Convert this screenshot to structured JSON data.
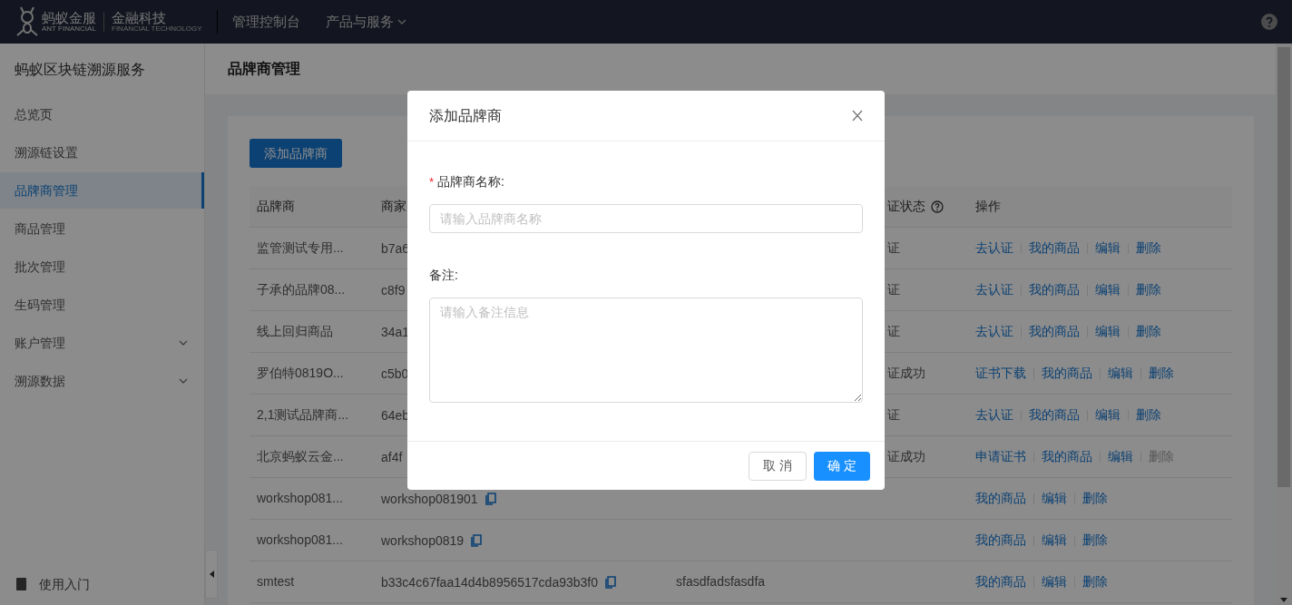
{
  "topbar": {
    "logo_cn": "蚂蚁金服",
    "logo_en": "ANT FINANCIAL",
    "brand_cn": "金融科技",
    "brand_en": "FINANCIAL TECHNOLOGY",
    "nav": [
      {
        "label": "管理控制台",
        "dropdown": false
      },
      {
        "label": "产品与服务",
        "dropdown": true
      }
    ]
  },
  "sidebar": {
    "title": "蚂蚁区块链溯源服务",
    "items": [
      {
        "label": "总览页",
        "selected": false,
        "expandable": false
      },
      {
        "label": "溯源链设置",
        "selected": false,
        "expandable": false
      },
      {
        "label": "品牌商管理",
        "selected": true,
        "expandable": false
      },
      {
        "label": "商品管理",
        "selected": false,
        "expandable": false
      },
      {
        "label": "批次管理",
        "selected": false,
        "expandable": false
      },
      {
        "label": "生码管理",
        "selected": false,
        "expandable": false
      },
      {
        "label": "账户管理",
        "selected": false,
        "expandable": true
      },
      {
        "label": "溯源数据",
        "selected": false,
        "expandable": true
      }
    ],
    "footer": "使用入门"
  },
  "page": {
    "title": "品牌商管理",
    "add_button": "添加品牌商",
    "table": {
      "columns": [
        {
          "label": "品牌商",
          "help": false
        },
        {
          "label": "商家",
          "help": false
        },
        {
          "label": "证状态",
          "help": true
        },
        {
          "label": "操作",
          "help": false
        }
      ],
      "rows": [
        {
          "brand": "监管测试专用...",
          "merchant": "b7a6",
          "status": "证",
          "actions": [
            {
              "label": "去认证",
              "disabled": false
            },
            {
              "label": "我的商品",
              "disabled": false
            },
            {
              "label": "编辑",
              "disabled": false
            },
            {
              "label": "删除",
              "disabled": false
            }
          ]
        },
        {
          "brand": "子承的品牌08...",
          "merchant": "c8f9",
          "status": "证",
          "actions": [
            {
              "label": "去认证",
              "disabled": false
            },
            {
              "label": "我的商品",
              "disabled": false
            },
            {
              "label": "编辑",
              "disabled": false
            },
            {
              "label": "删除",
              "disabled": false
            }
          ]
        },
        {
          "brand": "线上回归商品",
          "merchant": "34a1",
          "status": "证",
          "actions": [
            {
              "label": "去认证",
              "disabled": false
            },
            {
              "label": "我的商品",
              "disabled": false
            },
            {
              "label": "编辑",
              "disabled": false
            },
            {
              "label": "删除",
              "disabled": false
            }
          ]
        },
        {
          "brand": "罗伯特0819O...",
          "merchant": "c5b0",
          "status": "证成功",
          "actions": [
            {
              "label": "证书下载",
              "disabled": false
            },
            {
              "label": "我的商品",
              "disabled": false
            },
            {
              "label": "编辑",
              "disabled": false
            },
            {
              "label": "删除",
              "disabled": false
            }
          ]
        },
        {
          "brand": "2,1测试品牌商...",
          "merchant": "64eb",
          "status": "证",
          "actions": [
            {
              "label": "去认证",
              "disabled": false
            },
            {
              "label": "我的商品",
              "disabled": false
            },
            {
              "label": "编辑",
              "disabled": false
            },
            {
              "label": "删除",
              "disabled": false
            }
          ]
        },
        {
          "brand": "北京蚂蚁云金...",
          "merchant": "af4f",
          "status": "证成功",
          "actions": [
            {
              "label": "申请证书",
              "disabled": false
            },
            {
              "label": "我的商品",
              "disabled": false
            },
            {
              "label": "编辑",
              "disabled": false
            },
            {
              "label": "删除",
              "disabled": true
            }
          ]
        },
        {
          "brand": "workshop081...",
          "merchant": "workshop081901",
          "copy": true,
          "actions": [
            {
              "label": "我的商品",
              "disabled": false
            },
            {
              "label": "编辑",
              "disabled": false
            },
            {
              "label": "删除",
              "disabled": false
            }
          ]
        },
        {
          "brand": "workshop081...",
          "merchant": "workshop0819",
          "copy": true,
          "actions": [
            {
              "label": "我的商品",
              "disabled": false
            },
            {
              "label": "编辑",
              "disabled": false
            },
            {
              "label": "删除",
              "disabled": false
            }
          ]
        },
        {
          "brand": "smtest",
          "merchant": "b33c4c67faa14d4b8956517cda93b3f0",
          "copy": true,
          "column_3": "sfasdfadsfasdfa",
          "actions": [
            {
              "label": "我的商品",
              "disabled": false
            },
            {
              "label": "编辑",
              "disabled": false
            },
            {
              "label": "删除",
              "disabled": false
            }
          ]
        }
      ]
    }
  },
  "dialog": {
    "title": "添加品牌商",
    "fields": [
      {
        "kind": "input",
        "label": "品牌商名称:",
        "required": true,
        "required_mark": "*",
        "placeholder": "请输入品牌商名称"
      },
      {
        "kind": "textarea",
        "label": "备注:",
        "required": false,
        "placeholder": "请输入备注信息"
      }
    ],
    "buttons": [
      {
        "label": "取 消",
        "primary": false
      },
      {
        "label": "确 定",
        "primary": true
      }
    ]
  }
}
